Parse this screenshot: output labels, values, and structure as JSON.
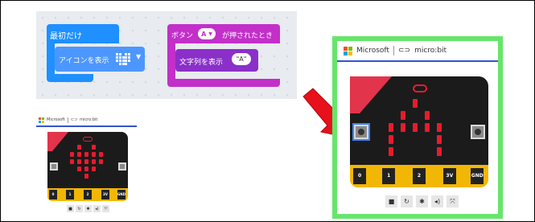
{
  "code": {
    "start_block": "最初だけ",
    "show_icon_block": "アイコンを表示",
    "icon_name": "heart-icon",
    "button_event": {
      "prefix": "ボタン",
      "button": "A",
      "suffix": "が押されたとき"
    },
    "show_string_block": "文字列を表示",
    "string_value": "\"A\""
  },
  "simulator_small": {
    "brand": "Microsoft",
    "product": "micro:bit",
    "pins": [
      "0",
      "1",
      "2",
      "3V",
      "GND"
    ],
    "controls": [
      "stop-icon",
      "restart-icon",
      "debug-icon",
      "sound-icon",
      "fullscreen-icon"
    ]
  },
  "simulator_large": {
    "brand": "Microsoft",
    "product": "micro:bit",
    "pins": [
      "0",
      "1",
      "2",
      "3V",
      "GND"
    ],
    "controls": [
      "stop-icon",
      "restart-icon",
      "debug-icon",
      "sound-icon",
      "fullscreen-icon"
    ],
    "highlight_color": "#66e66a",
    "arrow_color": "#e8101a"
  },
  "colors": {
    "basic_block": "#1e90ff",
    "input_block": "#c22fc9",
    "led_on": "#e81b2d",
    "board": "#1b1b1b",
    "edge_connector": "#f2b705",
    "brand_bar": "#3454d1"
  }
}
